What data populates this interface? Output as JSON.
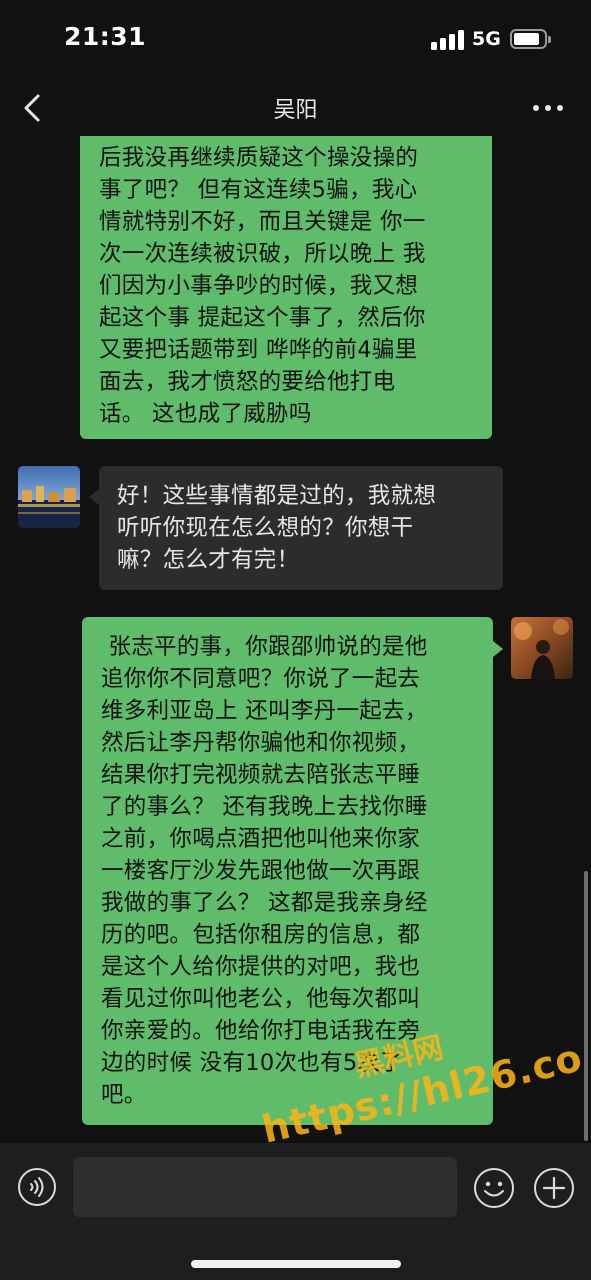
{
  "status_bar": {
    "time": "21:31",
    "network": "5G"
  },
  "nav": {
    "contact_name": "吴阳",
    "back_icon": "chevron-left-icon",
    "more_icon": "more-dots-icon"
  },
  "messages": [
    {
      "side": "right",
      "text": "后我没再继续质疑这个操没操的\n事了吧？ 但有这连续5骗，我心\n情就特别不好，而且关键是 你一\n次一次连续被识破，所以晚上 我\n们因为小事争吵的时候，我又想\n起这个事 提起这个事了，然后你\n又要把话题带到 哗哗的前4骗里\n面去，我才愤怒的要给他打电\n话。 这也成了威胁吗"
    },
    {
      "side": "left",
      "text": "好！这些事情都是过的，我就想\n听听你现在怎么想的？你想干\n嘛？怎么才有完！"
    },
    {
      "side": "right",
      "text": " 张志平的事，你跟邵帅说的是他\n追你你不同意吧？你说了一起去\n维多利亚岛上 还叫李丹一起去，\n然后让李丹帮你骗他和你视频，\n结果你打完视频就去陪张志平睡\n了的事么？ 还有我晚上去找你睡\n之前，你喝点酒把他叫他来你家\n一楼客厅沙发先跟他做一次再跟\n我做的事了么？ 这都是我亲身经\n历的吧。包括你租房的信息，都\n是这个人给你提供的对吧，我也\n看见过你叫他老公，他每次都叫\n你亲爱的。他给你打电话我在旁\n边的时候 没有10次也有5次了\n吧。"
    }
  ],
  "watermark": {
    "line1": "黑料网",
    "line2": "https://hl26.co"
  },
  "input_bar": {
    "voice_icon": "voice-icon",
    "emoji_icon": "emoji-icon",
    "plus_icon": "plus-icon",
    "input_value": ""
  },
  "colors": {
    "background": "#111111",
    "sent_bubble": "#5fbc6b",
    "received_bubble": "#2c2c2c",
    "input_bar": "#1e1e1e",
    "watermark": "#ffb414"
  }
}
